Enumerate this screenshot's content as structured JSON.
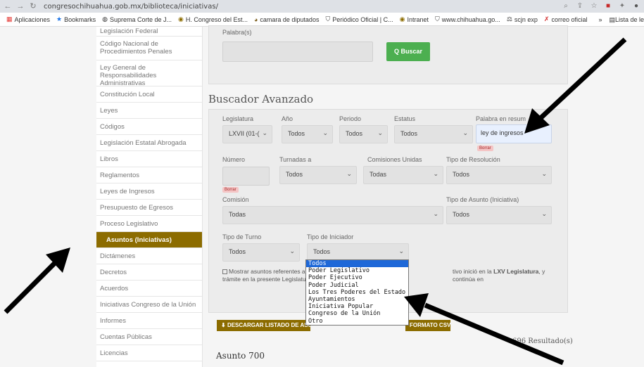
{
  "browser": {
    "url": "congresochihuahua.gob.mx/biblioteca/iniciativas/",
    "bookmarks": [
      "Aplicaciones",
      "Bookmarks",
      "Suprema Corte de J...",
      "H. Congreso del Est...",
      "camara de diputados",
      "Periódico Oficial | C...",
      "Intranet",
      "www.chihuahua.go...",
      "scjn exp",
      "correo oficial"
    ],
    "bookmarks_right": "Lista de le"
  },
  "sidebar": {
    "items": [
      "Legislación Federal",
      "Código Nacional de Procedimientos Penales",
      "Ley General de Responsabilidades Administrativas",
      "Constitución Local",
      "Leyes",
      "Códigos",
      "Legislación Estatal Abrogada",
      "Libros",
      "Reglamentos",
      "Leyes de Ingresos",
      "Presupuesto de Egresos",
      "Proceso Legislativo",
      "Asuntos (Iniciativas)",
      "Dictámenes",
      "Decretos",
      "Acuerdos",
      "Iniciativas Congreso de la Unión",
      "Informes",
      "Cuentas Públicas",
      "Licencias"
    ],
    "active": "Asuntos (Iniciativas)"
  },
  "search": {
    "palabras_label": "Palabra(s)",
    "buscar_button": "Q Buscar"
  },
  "advanced": {
    "title": "Buscador Avanzado",
    "legislatura_label": "Legislatura",
    "legislatura_value": "LXVII (01-(",
    "anio_label": "Año",
    "anio_value": "Todos",
    "periodo_label": "Periodo",
    "periodo_value": "Todos",
    "estatus_label": "Estatus",
    "estatus_value": "Todos",
    "palabra_resumen_label": "Palabra en resum",
    "palabra_resumen_value": "ley de ingresos",
    "borrar": "Borrar",
    "numero_label": "Número",
    "turnadas_label": "Turnadas a",
    "turnadas_value": "Todos",
    "comisiones_label": "Comisiones Unidas",
    "comisiones_value": "Todas",
    "tipo_resolucion_label": "Tipo de Resolución",
    "tipo_resolucion_value": "Todos",
    "comision_label": "Comisión",
    "comision_value": "Todas",
    "tipo_asunto_label": "Tipo de Asunto (Iniciativa)",
    "tipo_asunto_value": "Todos",
    "tipo_turno_label": "Tipo de Turno",
    "tipo_turno_value": "Todos",
    "tipo_iniciador_label": "Tipo de Iniciador",
    "tipo_iniciador_value": "Todos",
    "checkbox_text_a": "Mostrar asuntos referentes a",
    "checkbox_text_b": "tivo inició en la",
    "checkbox_text_bold": "LXV Legislatura",
    "checkbox_text_c": ", y continúa en",
    "checkbox_text_line2": "trámite en la presente Legislatu",
    "iniciador_options": [
      "Todos",
      "Poder Legislativo",
      "Poder Ejecutivo",
      "Poder Judicial",
      "Los Tres Poderes del Estado",
      "Ayuntamientos",
      "Iniciativa Popular",
      "Congreso de la Unión",
      "Otro"
    ]
  },
  "download": {
    "label_left": "DESCARGAR LISTADO DE ASU",
    "label_right": "FORMATO CSV"
  },
  "results": {
    "count": "696 Resultado(s)",
    "first": "Asunto 700"
  },
  "colors": {
    "accent_gold": "#8c6c00",
    "green_button": "#4caf50",
    "selected_option": "#1e68d8"
  }
}
